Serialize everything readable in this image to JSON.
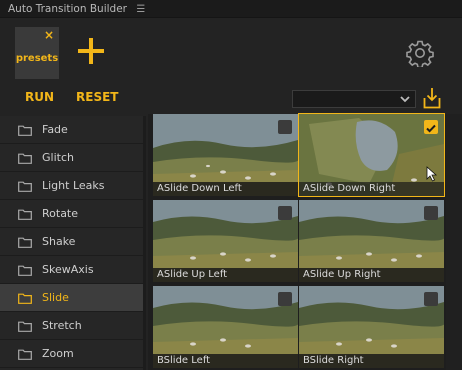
{
  "window": {
    "title": "Auto Transition Builder",
    "menu_icon": "hamburger-icon"
  },
  "toolbar": {
    "preset_tab_label": "presets",
    "preset_close": "×",
    "add_icon": "plus-icon",
    "settings_icon": "gear-icon"
  },
  "actions": {
    "run_label": "RUN",
    "reset_label": "RESET",
    "dropdown_value": "",
    "download_icon": "download-icon"
  },
  "sidebar": {
    "items": [
      {
        "label": "Fade",
        "active": false
      },
      {
        "label": "Glitch",
        "active": false
      },
      {
        "label": "Light Leaks",
        "active": false
      },
      {
        "label": "Rotate",
        "active": false
      },
      {
        "label": "Shake",
        "active": false
      },
      {
        "label": "SkewAxis",
        "active": false
      },
      {
        "label": "Slide",
        "active": true
      },
      {
        "label": "Stretch",
        "active": false
      },
      {
        "label": "Zoom",
        "active": false
      }
    ]
  },
  "grid": {
    "tiles": [
      {
        "caption": "ASlide Down Left",
        "checked": false,
        "selected": false
      },
      {
        "caption": "ASlide Down Right",
        "checked": true,
        "selected": true
      },
      {
        "caption": "ASlide Up Left",
        "checked": false,
        "selected": false
      },
      {
        "caption": "ASlide Up Right",
        "checked": false,
        "selected": false
      },
      {
        "caption": "BSlide Left",
        "checked": false,
        "selected": false
      },
      {
        "caption": "BSlide Right",
        "checked": false,
        "selected": false
      }
    ]
  },
  "colors": {
    "accent": "#f2b619",
    "background": "#232323"
  }
}
